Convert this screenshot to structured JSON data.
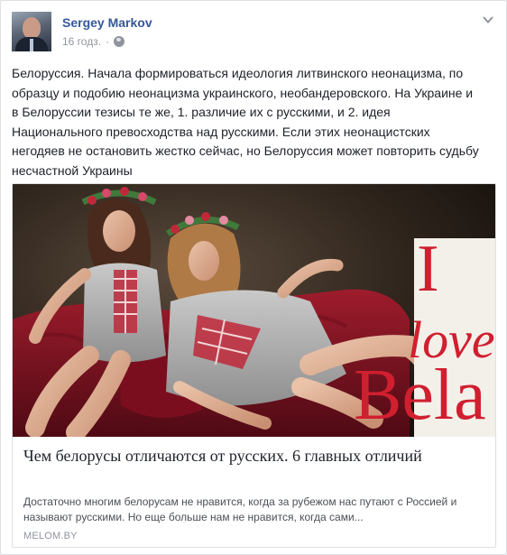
{
  "post": {
    "author": "Sergey Markov",
    "time": "16 годз.",
    "separator": "·",
    "privacy_icon": "globe-icon",
    "options_icon": "chevron-down-icon",
    "text": "Белоруссия. Начала формироваться идеология литвинского неонацизма, по образцу и подобию неонацизма украинского, необандеровского. На Украине и в Белоруссии тезисы те же, 1. различие их с русскими, и 2. идея Национального превосходства над русскими. Если этих неонацистских негодяев не остановить жестко сейчас, но Белоруссия может повторить судьбу несчастной Украины"
  },
  "link": {
    "image_overlay": {
      "top": "I",
      "middle": "love",
      "bottom": "Bela"
    },
    "title": "Чем белорусы отличаются от русских. 6 главных отличий",
    "description": "Достаточно многим белорусам не нравится, когда за рубежом нас путают с Россией и называют русскими. Но еще больше нам не нравится, когда сами...",
    "domain": "MELOM.BY"
  },
  "colors": {
    "link_blue": "#365899",
    "meta_gray": "#90949c",
    "embroidery_red": "#c0283a"
  }
}
